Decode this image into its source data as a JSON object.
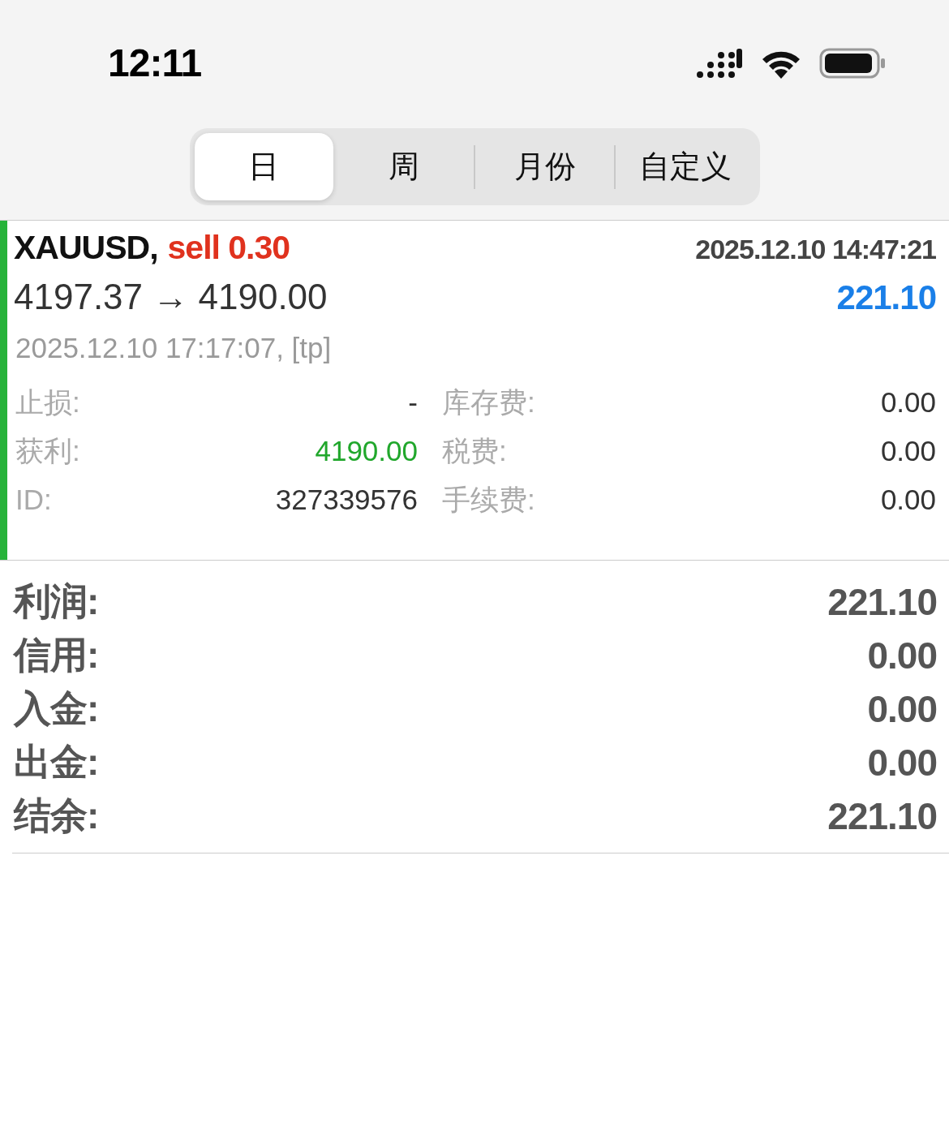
{
  "status_bar": {
    "time": "12:11"
  },
  "tabs": [
    {
      "label": "日",
      "selected": true
    },
    {
      "label": "周",
      "selected": false
    },
    {
      "label": "月份",
      "selected": false
    },
    {
      "label": "自定义",
      "selected": false
    }
  ],
  "trade": {
    "symbol": "XAUUSD,",
    "order": "sell 0.30",
    "open_time": "2025.12.10 14:47:21",
    "prices": "4197.37 → 4190.00",
    "profit": "221.10",
    "close_info": "2025.12.10 17:17:07, [tp]",
    "detail_rows": [
      {
        "fields": [
          {
            "label": "止损:",
            "value": "-",
            "kind": "plain"
          },
          {
            "label": "库存费:",
            "value": "0.00",
            "kind": "plain"
          }
        ]
      },
      {
        "fields": [
          {
            "label": "获利:",
            "value": "4190.00",
            "kind": "target"
          },
          {
            "label": "税费:",
            "value": "0.00",
            "kind": "plain"
          }
        ]
      },
      {
        "fields": [
          {
            "label": "ID:",
            "value": "327339576",
            "kind": "plain"
          },
          {
            "label": "手续费:",
            "value": "0.00",
            "kind": "plain"
          }
        ]
      }
    ]
  },
  "summary": [
    {
      "label": "利润:",
      "value": "221.10"
    },
    {
      "label": "信用:",
      "value": "0.00"
    },
    {
      "label": "入金:",
      "value": "0.00"
    },
    {
      "label": "出金:",
      "value": "0.00"
    },
    {
      "label": "结余:",
      "value": "221.10"
    }
  ]
}
